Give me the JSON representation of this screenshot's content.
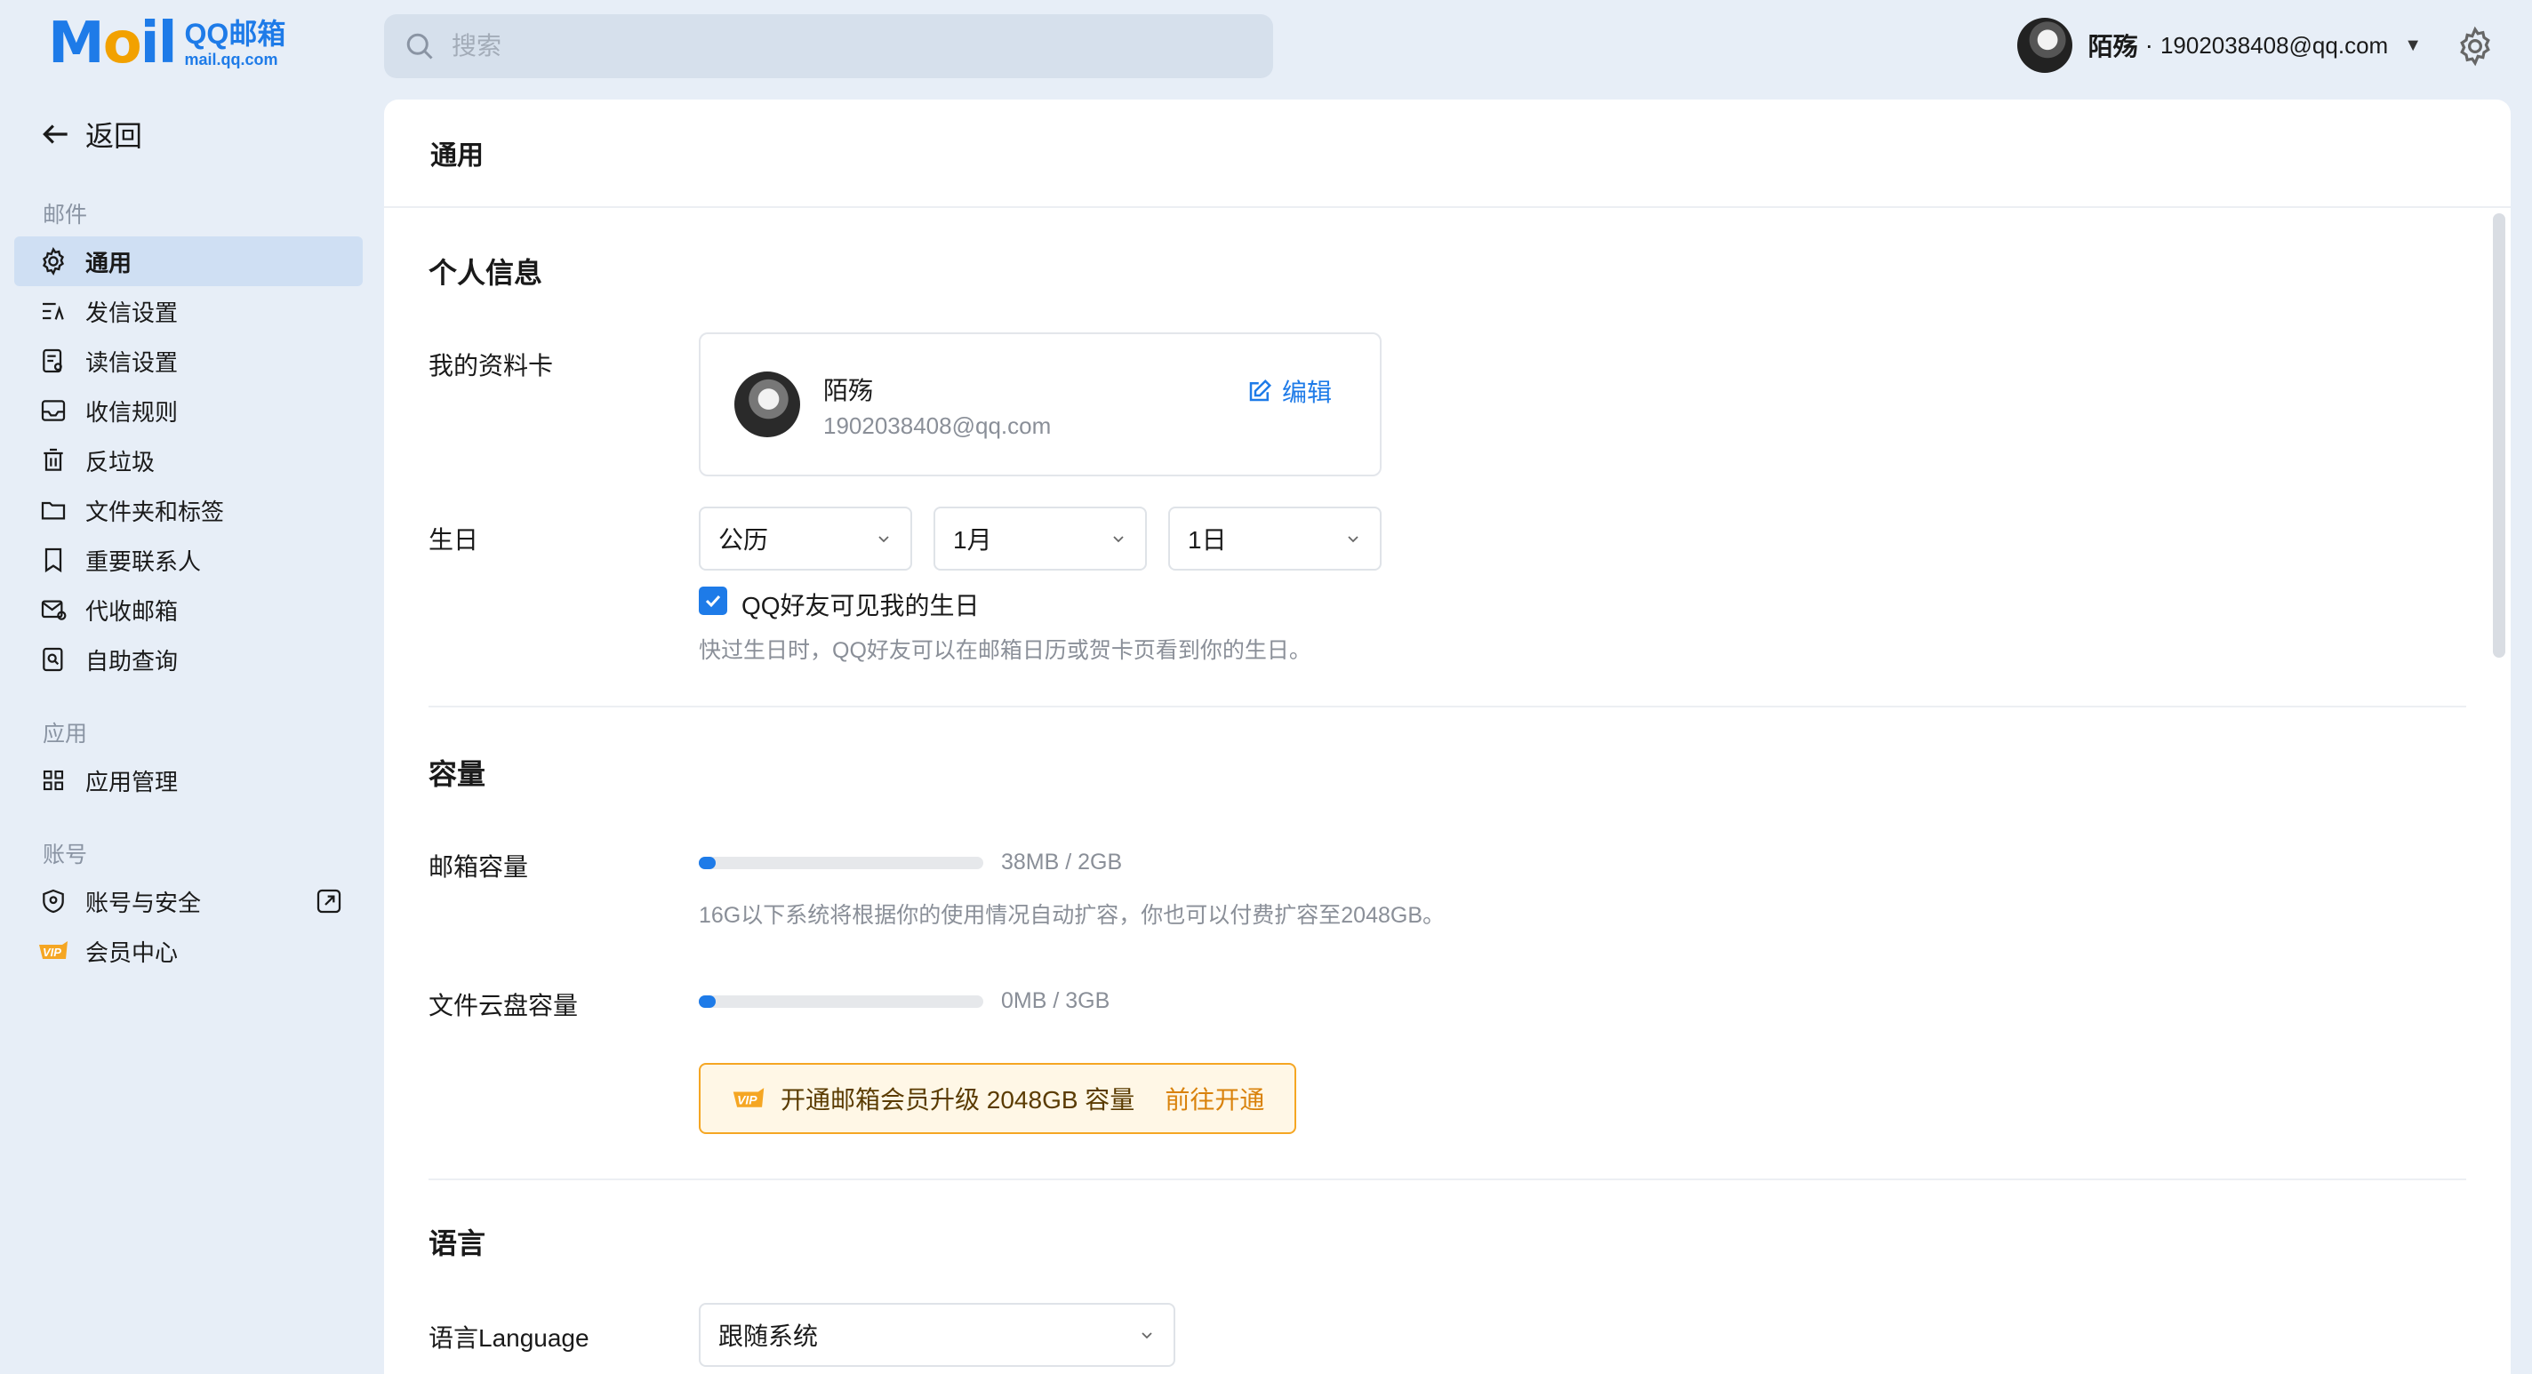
{
  "brand": {
    "mail": "Mail",
    "qq": "QQ邮箱",
    "url": "mail.qq.com"
  },
  "search": {
    "placeholder": "搜索"
  },
  "user": {
    "name": "陌殇",
    "separator": "·",
    "email": "1902038408@qq.com"
  },
  "sidebar": {
    "back_label": "返回",
    "groups": [
      {
        "title": "邮件",
        "items": [
          {
            "label": "通用",
            "icon": "gear-icon",
            "active": true
          },
          {
            "label": "发信设置",
            "icon": "compose-settings-icon"
          },
          {
            "label": "读信设置",
            "icon": "read-settings-icon"
          },
          {
            "label": "收信规则",
            "icon": "inbox-icon"
          },
          {
            "label": "反垃圾",
            "icon": "trash-icon"
          },
          {
            "label": "文件夹和标签",
            "icon": "folder-icon"
          },
          {
            "label": "重要联系人",
            "icon": "bookmark-icon"
          },
          {
            "label": "代收邮箱",
            "icon": "mail-sync-icon"
          },
          {
            "label": "自助查询",
            "icon": "search-doc-icon"
          }
        ]
      },
      {
        "title": "应用",
        "items": [
          {
            "label": "应用管理",
            "icon": "grid-icon"
          }
        ]
      },
      {
        "title": "账号",
        "items": [
          {
            "label": "账号与安全",
            "icon": "shield-icon"
          },
          {
            "label": "会员中心",
            "icon": "vip-icon"
          }
        ]
      }
    ]
  },
  "main": {
    "title": "通用",
    "personal": {
      "title": "个人信息",
      "card_label": "我的资料卡",
      "card": {
        "name": "陌殇",
        "email": "1902038408@qq.com",
        "edit": "编辑"
      },
      "birthday_label": "生日",
      "calendar": "公历",
      "month": "1月",
      "day": "1日",
      "checkbox_label": "QQ好友可见我的生日",
      "checkbox_checked": true,
      "hint": "快过生日时，QQ好友可以在邮箱日历或贺卡页看到你的生日。"
    },
    "capacity": {
      "title": "容量",
      "mailbox_label": "邮箱容量",
      "mailbox_usage": "38MB / 2GB",
      "mailbox_fraction": 0.06,
      "mailbox_hint": "16G以下系统将根据你的使用情况自动扩容，你也可以付费扩容至2048GB。",
      "disk_label": "文件云盘容量",
      "disk_usage": "0MB / 3GB",
      "disk_fraction": 0.06,
      "vip_text": "开通邮箱会员升级 2048GB 容量",
      "vip_cta": "前往开通"
    },
    "language": {
      "title": "语言",
      "label": "语言Language",
      "value": "跟随系统"
    }
  },
  "colors": {
    "accent": "#1e7be8",
    "vip": "#f5a623",
    "sidebar_bg": "#e7eef7"
  }
}
